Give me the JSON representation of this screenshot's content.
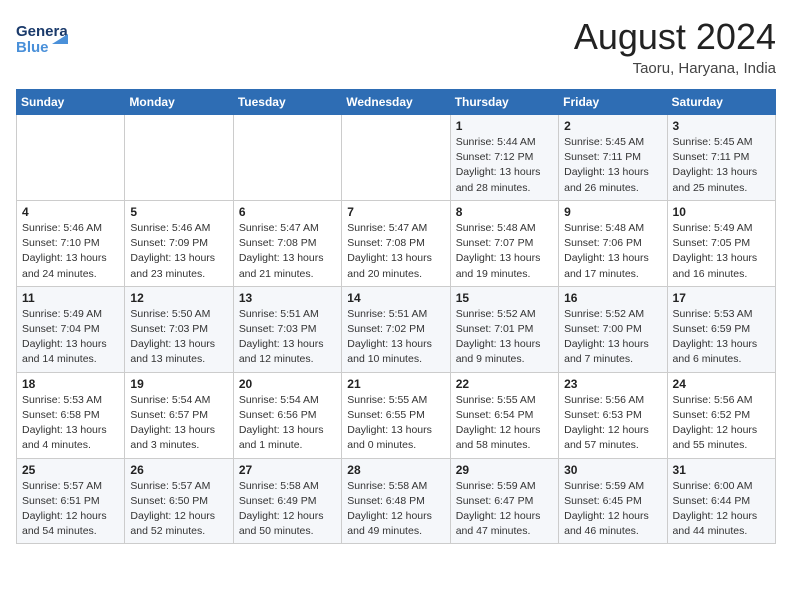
{
  "header": {
    "logo_general": "General",
    "logo_blue": "Blue",
    "month_year": "August 2024",
    "location": "Taoru, Haryana, India"
  },
  "weekdays": [
    "Sunday",
    "Monday",
    "Tuesday",
    "Wednesday",
    "Thursday",
    "Friday",
    "Saturday"
  ],
  "weeks": [
    [
      {
        "day": "",
        "detail": ""
      },
      {
        "day": "",
        "detail": ""
      },
      {
        "day": "",
        "detail": ""
      },
      {
        "day": "",
        "detail": ""
      },
      {
        "day": "1",
        "detail": "Sunrise: 5:44 AM\nSunset: 7:12 PM\nDaylight: 13 hours\nand 28 minutes."
      },
      {
        "day": "2",
        "detail": "Sunrise: 5:45 AM\nSunset: 7:11 PM\nDaylight: 13 hours\nand 26 minutes."
      },
      {
        "day": "3",
        "detail": "Sunrise: 5:45 AM\nSunset: 7:11 PM\nDaylight: 13 hours\nand 25 minutes."
      }
    ],
    [
      {
        "day": "4",
        "detail": "Sunrise: 5:46 AM\nSunset: 7:10 PM\nDaylight: 13 hours\nand 24 minutes."
      },
      {
        "day": "5",
        "detail": "Sunrise: 5:46 AM\nSunset: 7:09 PM\nDaylight: 13 hours\nand 23 minutes."
      },
      {
        "day": "6",
        "detail": "Sunrise: 5:47 AM\nSunset: 7:08 PM\nDaylight: 13 hours\nand 21 minutes."
      },
      {
        "day": "7",
        "detail": "Sunrise: 5:47 AM\nSunset: 7:08 PM\nDaylight: 13 hours\nand 20 minutes."
      },
      {
        "day": "8",
        "detail": "Sunrise: 5:48 AM\nSunset: 7:07 PM\nDaylight: 13 hours\nand 19 minutes."
      },
      {
        "day": "9",
        "detail": "Sunrise: 5:48 AM\nSunset: 7:06 PM\nDaylight: 13 hours\nand 17 minutes."
      },
      {
        "day": "10",
        "detail": "Sunrise: 5:49 AM\nSunset: 7:05 PM\nDaylight: 13 hours\nand 16 minutes."
      }
    ],
    [
      {
        "day": "11",
        "detail": "Sunrise: 5:49 AM\nSunset: 7:04 PM\nDaylight: 13 hours\nand 14 minutes."
      },
      {
        "day": "12",
        "detail": "Sunrise: 5:50 AM\nSunset: 7:03 PM\nDaylight: 13 hours\nand 13 minutes."
      },
      {
        "day": "13",
        "detail": "Sunrise: 5:51 AM\nSunset: 7:03 PM\nDaylight: 13 hours\nand 12 minutes."
      },
      {
        "day": "14",
        "detail": "Sunrise: 5:51 AM\nSunset: 7:02 PM\nDaylight: 13 hours\nand 10 minutes."
      },
      {
        "day": "15",
        "detail": "Sunrise: 5:52 AM\nSunset: 7:01 PM\nDaylight: 13 hours\nand 9 minutes."
      },
      {
        "day": "16",
        "detail": "Sunrise: 5:52 AM\nSunset: 7:00 PM\nDaylight: 13 hours\nand 7 minutes."
      },
      {
        "day": "17",
        "detail": "Sunrise: 5:53 AM\nSunset: 6:59 PM\nDaylight: 13 hours\nand 6 minutes."
      }
    ],
    [
      {
        "day": "18",
        "detail": "Sunrise: 5:53 AM\nSunset: 6:58 PM\nDaylight: 13 hours\nand 4 minutes."
      },
      {
        "day": "19",
        "detail": "Sunrise: 5:54 AM\nSunset: 6:57 PM\nDaylight: 13 hours\nand 3 minutes."
      },
      {
        "day": "20",
        "detail": "Sunrise: 5:54 AM\nSunset: 6:56 PM\nDaylight: 13 hours\nand 1 minute."
      },
      {
        "day": "21",
        "detail": "Sunrise: 5:55 AM\nSunset: 6:55 PM\nDaylight: 13 hours\nand 0 minutes."
      },
      {
        "day": "22",
        "detail": "Sunrise: 5:55 AM\nSunset: 6:54 PM\nDaylight: 12 hours\nand 58 minutes."
      },
      {
        "day": "23",
        "detail": "Sunrise: 5:56 AM\nSunset: 6:53 PM\nDaylight: 12 hours\nand 57 minutes."
      },
      {
        "day": "24",
        "detail": "Sunrise: 5:56 AM\nSunset: 6:52 PM\nDaylight: 12 hours\nand 55 minutes."
      }
    ],
    [
      {
        "day": "25",
        "detail": "Sunrise: 5:57 AM\nSunset: 6:51 PM\nDaylight: 12 hours\nand 54 minutes."
      },
      {
        "day": "26",
        "detail": "Sunrise: 5:57 AM\nSunset: 6:50 PM\nDaylight: 12 hours\nand 52 minutes."
      },
      {
        "day": "27",
        "detail": "Sunrise: 5:58 AM\nSunset: 6:49 PM\nDaylight: 12 hours\nand 50 minutes."
      },
      {
        "day": "28",
        "detail": "Sunrise: 5:58 AM\nSunset: 6:48 PM\nDaylight: 12 hours\nand 49 minutes."
      },
      {
        "day": "29",
        "detail": "Sunrise: 5:59 AM\nSunset: 6:47 PM\nDaylight: 12 hours\nand 47 minutes."
      },
      {
        "day": "30",
        "detail": "Sunrise: 5:59 AM\nSunset: 6:45 PM\nDaylight: 12 hours\nand 46 minutes."
      },
      {
        "day": "31",
        "detail": "Sunrise: 6:00 AM\nSunset: 6:44 PM\nDaylight: 12 hours\nand 44 minutes."
      }
    ]
  ]
}
